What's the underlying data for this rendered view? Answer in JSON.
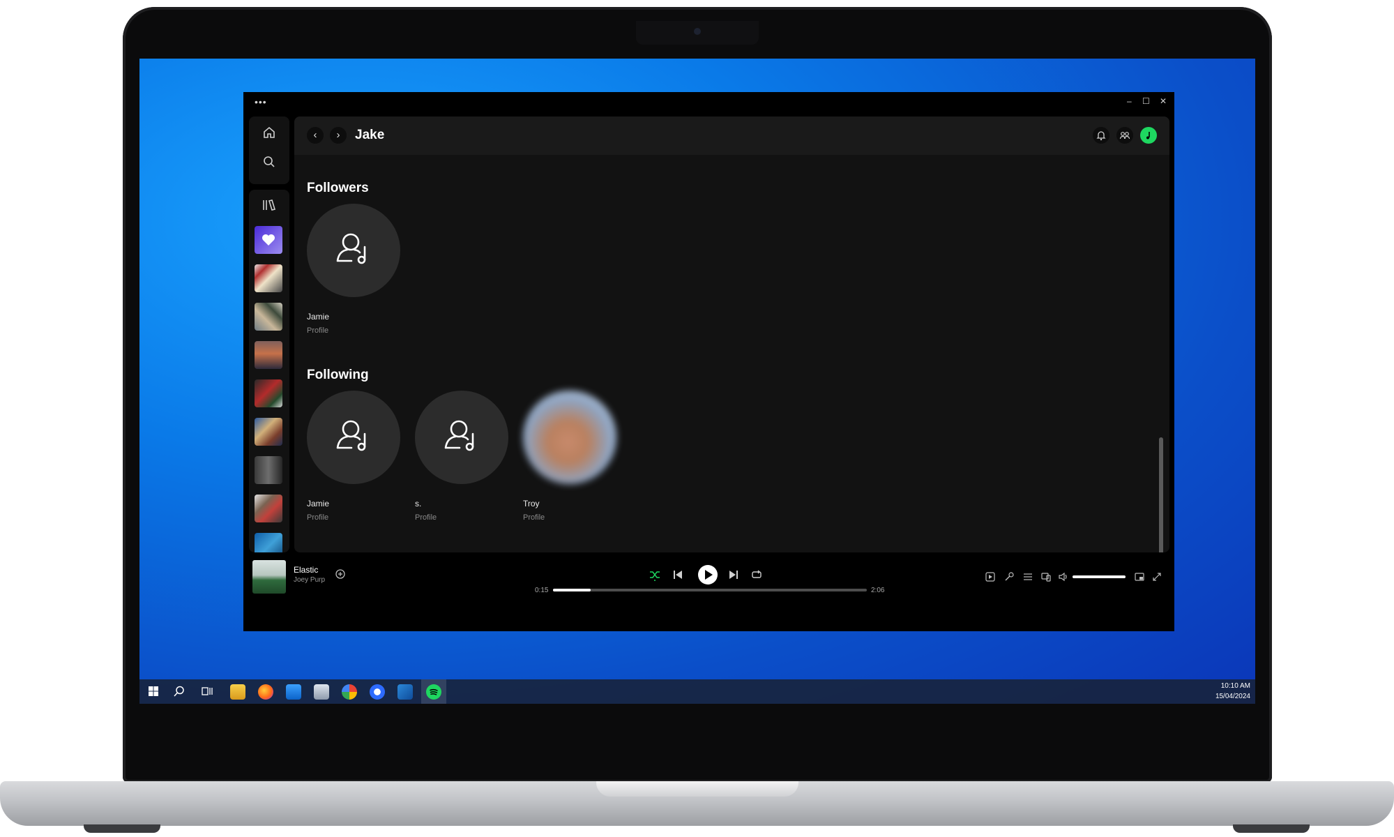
{
  "app": {
    "titlebar_dots": "•••",
    "window_controls": {
      "minimize": "–",
      "maximize": "☐",
      "close": "✕"
    }
  },
  "header": {
    "back_icon": "‹",
    "forward_icon": "›",
    "title": "Jake"
  },
  "followers": {
    "title": "Followers",
    "items": [
      {
        "name": "Jamie",
        "type": "Profile"
      }
    ]
  },
  "following": {
    "title": "Following",
    "items": [
      {
        "name": "Jamie",
        "type": "Profile"
      },
      {
        "name": "s.",
        "type": "Profile"
      },
      {
        "name": "Troy",
        "type": "Profile"
      }
    ]
  },
  "now_playing": {
    "title": "Elastic",
    "artist": "Joey Purp",
    "elapsed": "0:15",
    "duration": "2:06",
    "progress": 0.12,
    "volume": 1.0
  },
  "taskbar": {
    "time": "10:10 AM",
    "date": "15/04/2024"
  },
  "colors": {
    "accent": "#1ed760",
    "background": "#121212",
    "desktop": "#0a7ae8"
  }
}
